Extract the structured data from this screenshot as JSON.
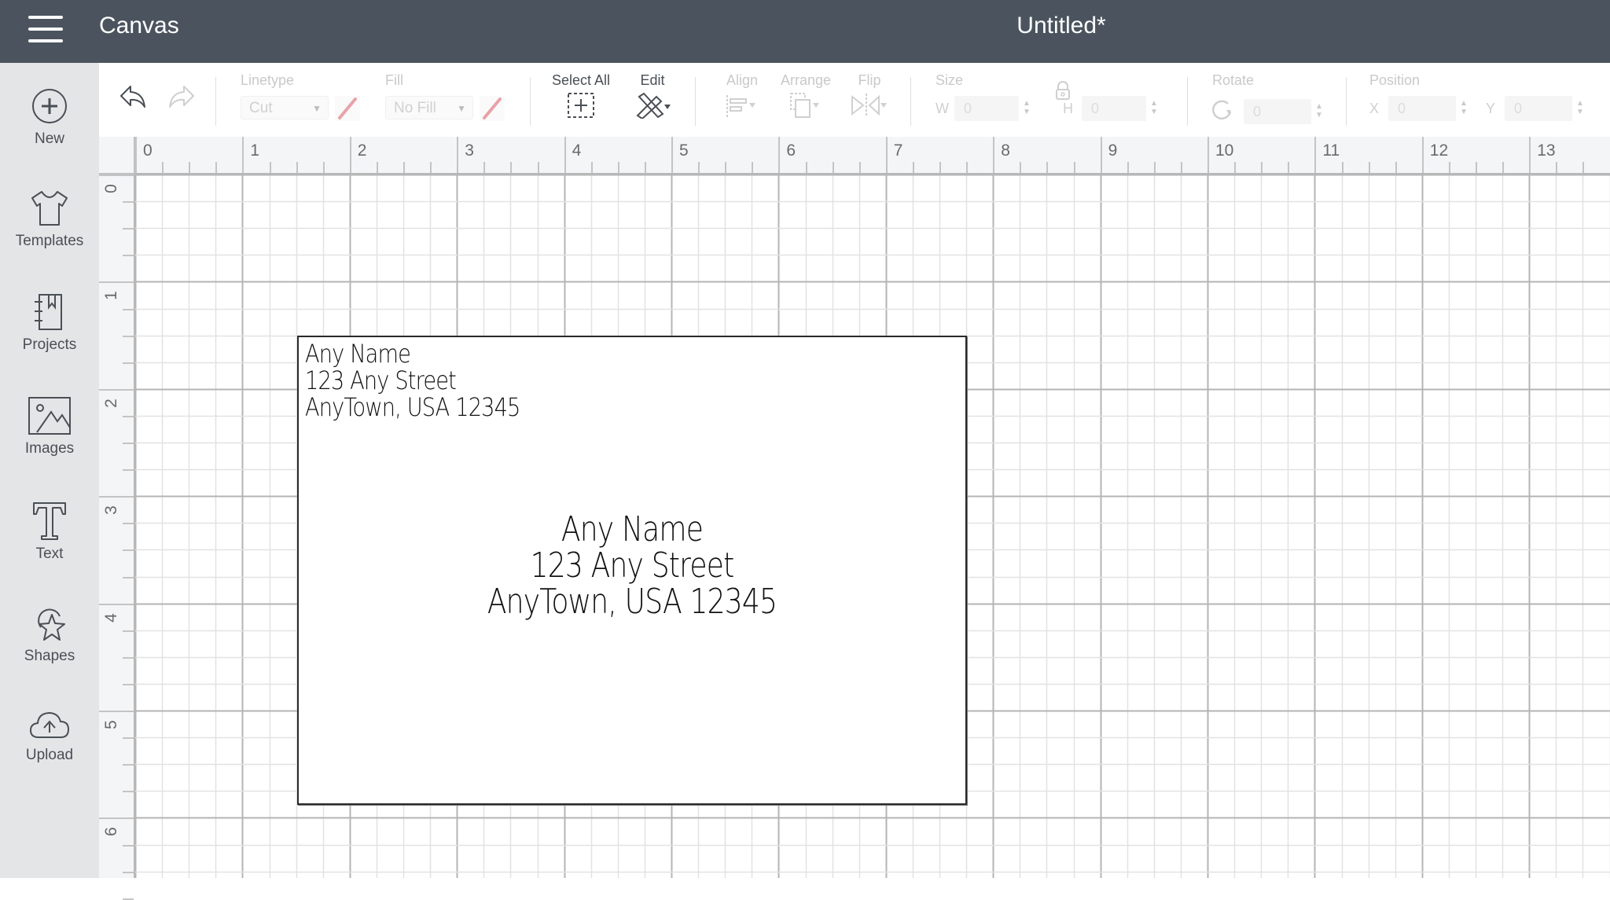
{
  "header": {
    "app_title": "Canvas",
    "document_title": "Untitled*"
  },
  "sidebar": {
    "items": [
      {
        "id": "new",
        "label": "New",
        "icon": "plus-circle-icon"
      },
      {
        "id": "templates",
        "label": "Templates",
        "icon": "tshirt-icon"
      },
      {
        "id": "projects",
        "label": "Projects",
        "icon": "notebook-icon"
      },
      {
        "id": "images",
        "label": "Images",
        "icon": "image-icon"
      },
      {
        "id": "text",
        "label": "Text",
        "icon": "text-t-icon"
      },
      {
        "id": "shapes",
        "label": "Shapes",
        "icon": "shapes-icon"
      },
      {
        "id": "upload",
        "label": "Upload",
        "icon": "cloud-upload-icon"
      }
    ]
  },
  "toolbar": {
    "undo": "undo-icon",
    "redo": "redo-icon",
    "linetype": {
      "label": "Linetype",
      "value": "Cut"
    },
    "fill": {
      "label": "Fill",
      "value": "No Fill"
    },
    "select_all": {
      "label": "Select All"
    },
    "edit": {
      "label": "Edit"
    },
    "align": {
      "label": "Align"
    },
    "arrange": {
      "label": "Arrange"
    },
    "flip": {
      "label": "Flip"
    },
    "size": {
      "label": "Size",
      "w_label": "W",
      "w_value": "0",
      "h_label": "H",
      "h_value": "0"
    },
    "rotate": {
      "label": "Rotate",
      "value": "0"
    },
    "position": {
      "label": "Position",
      "x_label": "X",
      "x_value": "0",
      "y_label": "Y",
      "y_value": "0"
    }
  },
  "rulers": {
    "horizontal": [
      "0",
      "1",
      "2",
      "3",
      "4",
      "5",
      "6",
      "7",
      "8",
      "9",
      "10",
      "11",
      "12",
      "13"
    ],
    "vertical": [
      "0",
      "1",
      "2",
      "3",
      "4",
      "5",
      "6"
    ]
  },
  "canvas": {
    "return_address": [
      "Any Name",
      "123 Any Street",
      "AnyTown, USA 12345"
    ],
    "recipient_address": [
      "Any Name",
      "123 Any Street",
      "AnyTown, USA 12345"
    ]
  }
}
